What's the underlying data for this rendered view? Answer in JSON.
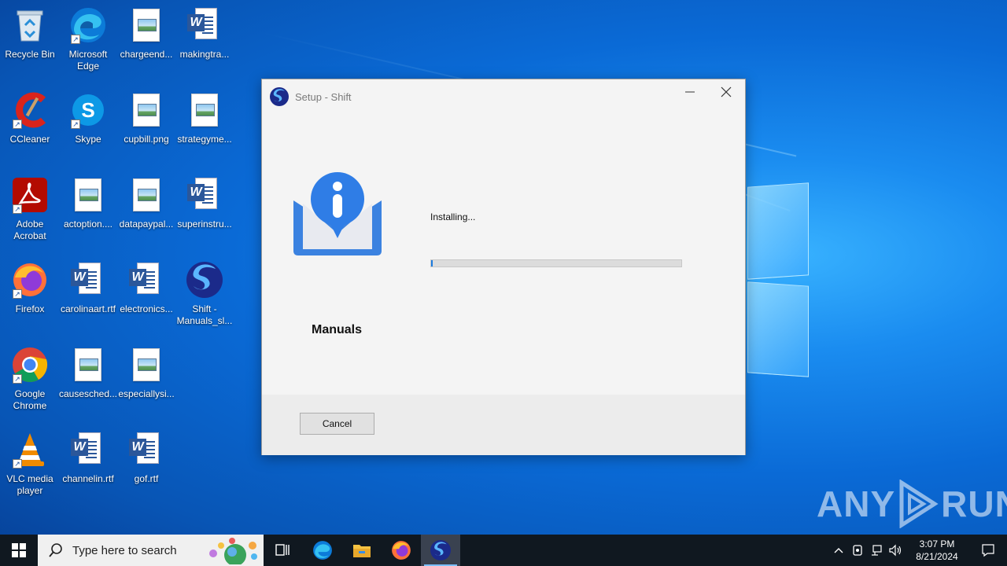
{
  "desktop": {
    "icons": [
      {
        "label": "Recycle Bin"
      },
      {
        "label": "Microsoft Edge"
      },
      {
        "label": "chargeend..."
      },
      {
        "label": "makingtra..."
      },
      {
        "label": "CCleaner"
      },
      {
        "label": "Skype"
      },
      {
        "label": "cupbill.png"
      },
      {
        "label": "strategyme..."
      },
      {
        "label": "Adobe Acrobat"
      },
      {
        "label": "actoption...."
      },
      {
        "label": "datapaypal..."
      },
      {
        "label": "superinstru..."
      },
      {
        "label": "Firefox"
      },
      {
        "label": "carolinaart.rtf"
      },
      {
        "label": "electronics..."
      },
      {
        "label": "Shift - Manuals_sl..."
      },
      {
        "label": "Google Chrome"
      },
      {
        "label": "causesched..."
      },
      {
        "label": "especiallysi..."
      },
      {
        "label": "VLC media player"
      },
      {
        "label": "channelin.rtf"
      },
      {
        "label": "gof.rtf"
      }
    ]
  },
  "setup_window": {
    "title": "Setup - Shift",
    "app_name": "Manuals",
    "status": "Installing...",
    "progress": 0.005,
    "cancel_label": "Cancel",
    "accent": "#1d7ce0"
  },
  "watermark": {
    "left": "ANY",
    "right": "RUN"
  },
  "taskbar": {
    "search_placeholder": "Type here to search",
    "time": "3:07 PM",
    "date": "8/21/2024",
    "pinned": [
      "task-view-icon",
      "edge-icon",
      "file-explorer-icon",
      "firefox-icon",
      "shift-icon"
    ]
  }
}
